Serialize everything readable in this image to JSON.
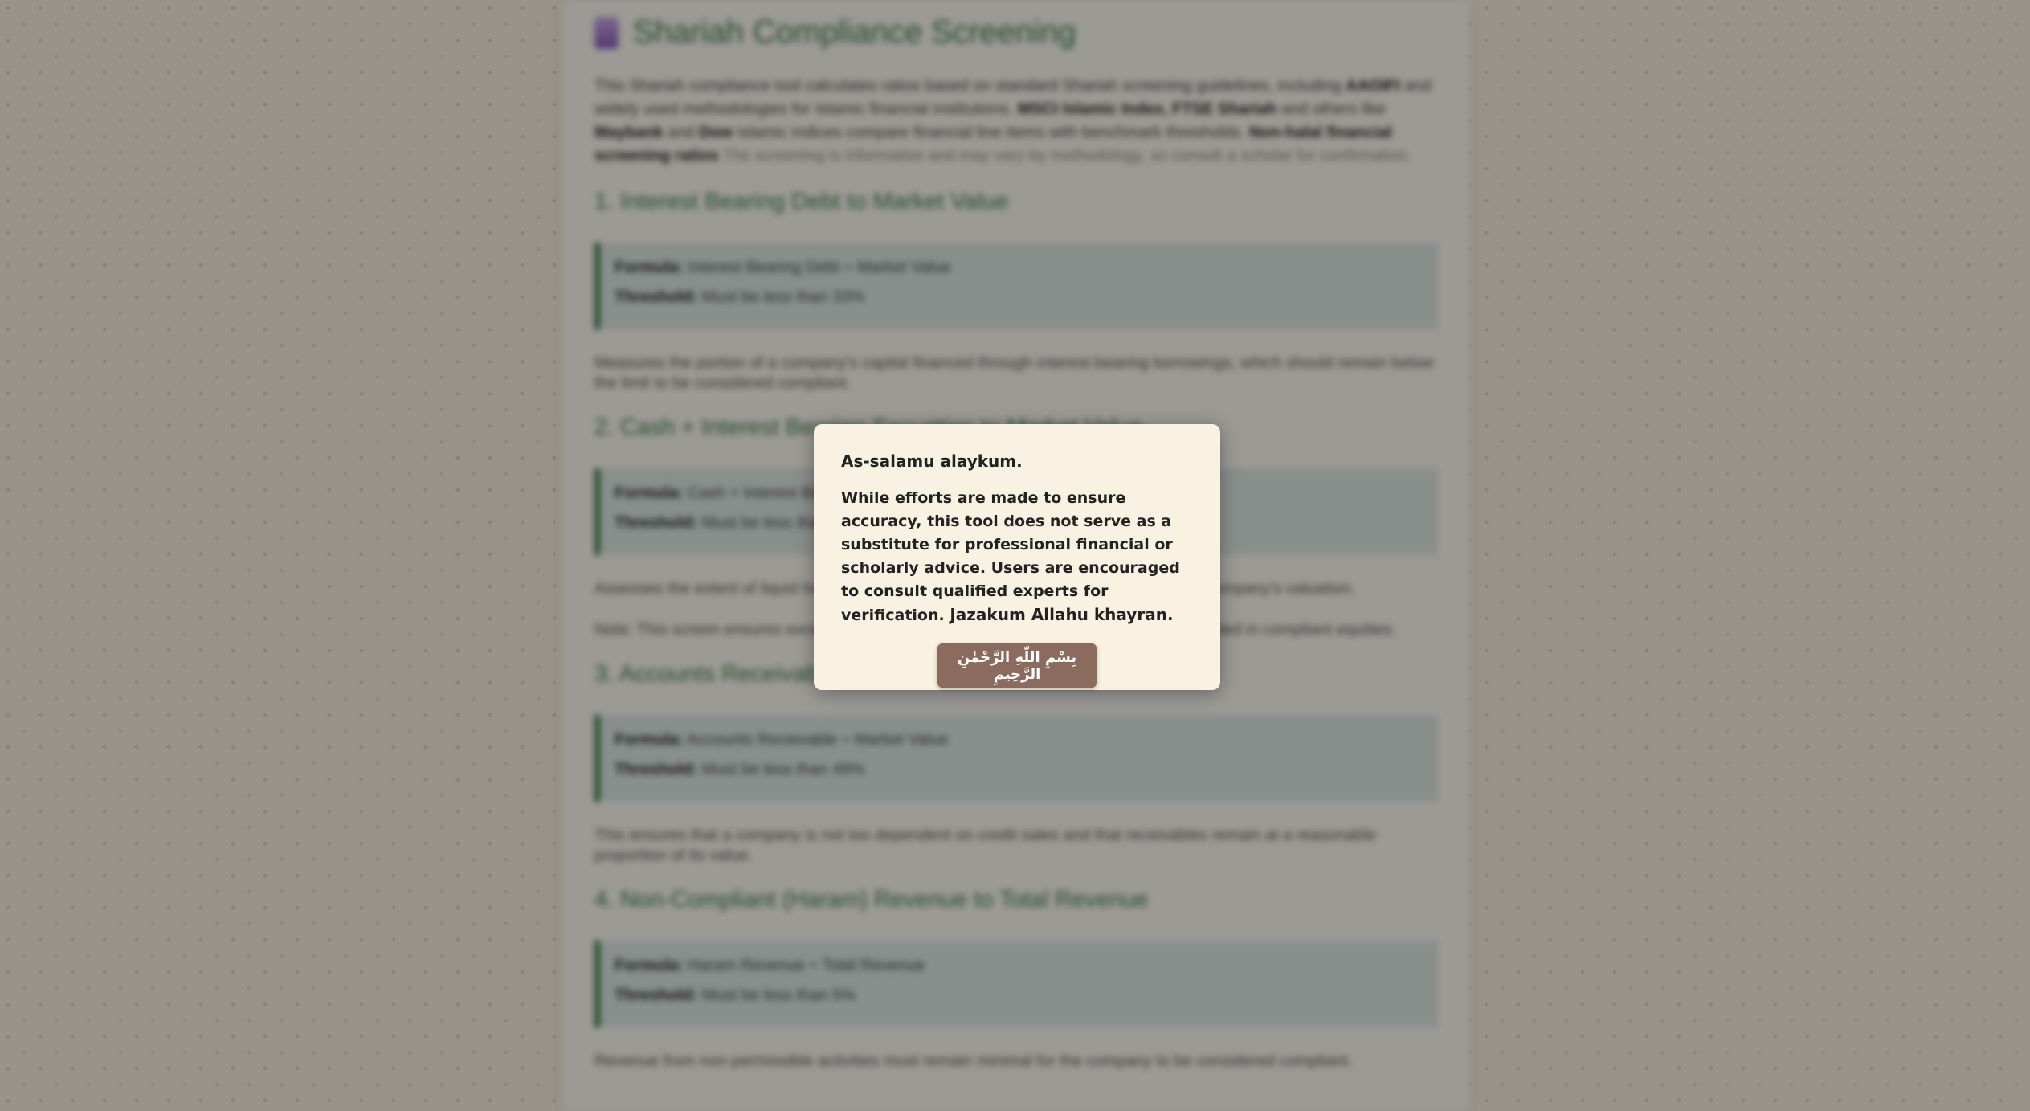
{
  "page": {
    "title": "Shariah Compliance Screening",
    "intro": {
      "part1": "This Shariah compliance tool calculates ratios based on standard Shariah screening guidelines, including",
      "bold1": "AAOIFI",
      "part2": "and widely used methodologies for Islamic financial institutions.",
      "bold2": "MSCI Islamic Index, FTSE Shariah",
      "part3": "and others like",
      "bold3": "Maybank",
      "part4": "and",
      "bold4": "Dow",
      "part5": "Islamic indices compare financial line items with benchmark thresholds.",
      "bold5": "Non-halal financial screening ratios",
      "faded": "The screening is informative and may vary by methodology, so consult a scholar for confirmation."
    },
    "sections": [
      {
        "title": "1. Interest Bearing Debt to Market Value",
        "formula_label": "Formula:",
        "formula_value": "Interest Bearing Debt ÷ Market Value",
        "threshold_label": "Threshold:",
        "threshold_value": "Must be less than 33%",
        "para": "Measures the portion of a company's capital financed through interest-bearing borrowings, which should remain below the limit to be considered compliant."
      },
      {
        "title": "2. Cash + Interest Bearing Securities to Market Value",
        "formula_label": "Formula:",
        "formula_value": "Cash + Interest Bearing Securities ÷ Market Value",
        "threshold_label": "Threshold:",
        "threshold_value": "Must be less than 33%",
        "para": "Assesses the extent of liquid holdings and interest-bearing investments relative to the company's valuation.",
        "para2": "Note: This screen ensures excessive holdings of cash and interest instruments are avoided in compliant equities."
      },
      {
        "title": "3. Accounts Receivable to Market Value",
        "formula_label": "Formula:",
        "formula_value": "Accounts Receivable ÷ Market Value",
        "threshold_label": "Threshold:",
        "threshold_value": "Must be less than 49%",
        "para": "This ensures that a company is not too dependent on credit sales and that receivables remain at a reasonable proportion of its value."
      },
      {
        "title": "4. Non-Compliant (Haram) Revenue to Total Revenue",
        "formula_label": "Formula:",
        "formula_value": "Haram Revenue ÷ Total Revenue",
        "threshold_label": "Threshold:",
        "threshold_value": "Must be less than 5%",
        "para": "Revenue from non-permissible activities must remain minimal for the company to be considered compliant."
      }
    ]
  },
  "modal": {
    "greeting": "As-salamu alaykum.",
    "body": "While efforts are made to ensure accuracy, this tool does not serve as a substitute for professional financial or scholarly advice. Users are encouraged to consult qualified experts for verification.",
    "closing": "Jazakum Allahu khayran.",
    "button_label": "بِسْمِ اللّٰهِ الرَّحْمٰنِ الرَّحِيمِ"
  },
  "colors": {
    "heading": "#3a7a4c",
    "modal_bg": "#f9f2e2",
    "button_bg": "#8b6b5d",
    "overlay": "rgba(0,0,0,0.38)"
  }
}
